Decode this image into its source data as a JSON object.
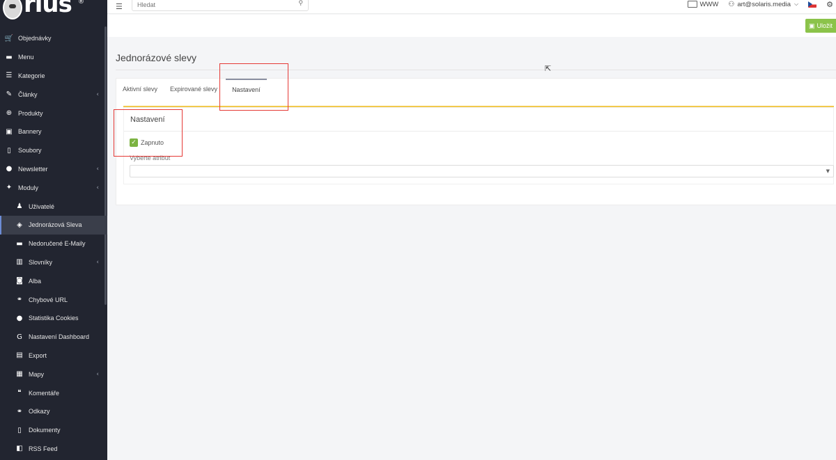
{
  "logo": {
    "brand": "rius",
    "reg_mark": "®"
  },
  "sidebar": {
    "items": [
      {
        "label": "Objednávky",
        "icon": "cart-icon",
        "glyph": "🛒",
        "sub": false,
        "chev": false,
        "active": false
      },
      {
        "label": "Menu",
        "icon": "folder-icon",
        "glyph": "▬",
        "sub": false,
        "chev": false,
        "active": false
      },
      {
        "label": "Kategorie",
        "icon": "list-icon",
        "glyph": "☰",
        "sub": false,
        "chev": false,
        "active": false
      },
      {
        "label": "Články",
        "icon": "pen-icon",
        "glyph": "✎",
        "sub": false,
        "chev": true,
        "active": false
      },
      {
        "label": "Produkty",
        "icon": "globe-icon",
        "glyph": "⊕",
        "sub": false,
        "chev": false,
        "active": false
      },
      {
        "label": "Bannery",
        "icon": "image-icon",
        "glyph": "▣",
        "sub": false,
        "chev": false,
        "active": false
      },
      {
        "label": "Soubory",
        "icon": "file-icon",
        "glyph": "▯",
        "sub": false,
        "chev": false,
        "active": false
      },
      {
        "label": "Newsletter",
        "icon": "newsletter-icon",
        "glyph": "●",
        "sub": false,
        "chev": true,
        "active": false
      },
      {
        "label": "Moduly",
        "icon": "modules-icon",
        "glyph": "✦",
        "sub": false,
        "chev": true,
        "active": false
      },
      {
        "label": "Uživatelé",
        "icon": "user-icon",
        "glyph": "♟",
        "sub": true,
        "chev": false,
        "active": false
      },
      {
        "label": "Jednorázová Sleva",
        "icon": "tag-icon",
        "glyph": "◈",
        "sub": true,
        "chev": false,
        "active": true
      },
      {
        "label": "Nedoručené E-Maily",
        "icon": "mail-icon",
        "glyph": "▬",
        "sub": true,
        "chev": false,
        "active": false
      },
      {
        "label": "Slovníky",
        "icon": "books-icon",
        "glyph": "▥",
        "sub": true,
        "chev": true,
        "active": false
      },
      {
        "label": "Alba",
        "icon": "camera-icon",
        "glyph": "◙",
        "sub": true,
        "chev": false,
        "active": false
      },
      {
        "label": "Chybové URL",
        "icon": "link-icon",
        "glyph": "⚭",
        "sub": true,
        "chev": false,
        "active": false
      },
      {
        "label": "Statistika Cookies",
        "icon": "cookie-icon",
        "glyph": "●",
        "sub": true,
        "chev": false,
        "active": false
      },
      {
        "label": "Nastavení Dashboard",
        "icon": "google-icon",
        "glyph": "G",
        "sub": true,
        "chev": false,
        "active": false
      },
      {
        "label": "Export",
        "icon": "export-icon",
        "glyph": "▤",
        "sub": true,
        "chev": false,
        "active": false
      },
      {
        "label": "Mapy",
        "icon": "map-icon",
        "glyph": "▦",
        "sub": true,
        "chev": true,
        "active": false
      },
      {
        "label": "Komentáře",
        "icon": "comments-icon",
        "glyph": "❝",
        "sub": true,
        "chev": false,
        "active": false
      },
      {
        "label": "Odkazy",
        "icon": "link-icon",
        "glyph": "⚭",
        "sub": true,
        "chev": false,
        "active": false
      },
      {
        "label": "Dokumenty",
        "icon": "document-icon",
        "glyph": "▯",
        "sub": true,
        "chev": false,
        "active": false
      },
      {
        "label": "RSS Feed",
        "icon": "rss-icon",
        "glyph": "◧",
        "sub": true,
        "chev": false,
        "active": false
      }
    ]
  },
  "topbar": {
    "search_placeholder": "Hledat",
    "www_label": "WWW",
    "user_email": "art@solaris.media"
  },
  "toolbar": {
    "save_label": "Uložit"
  },
  "page": {
    "title": "Jednorázové slevy"
  },
  "tabs": [
    {
      "label": "Aktivní slevy",
      "active": false
    },
    {
      "label": "Expirované slevy",
      "active": false
    },
    {
      "label": "Nastavení",
      "active": true
    }
  ],
  "settings": {
    "panel_title": "Nastavení",
    "enabled_label": "Zapnuto",
    "enabled": true,
    "attribute_label": "Vyberte atribut",
    "attribute_value": ""
  },
  "colors": {
    "sidebar_bg": "#222530",
    "save_button": "#8bc34a",
    "panel_accent": "#f2c94c",
    "checkbox": "#7cb342",
    "annotation": "#e53935"
  }
}
